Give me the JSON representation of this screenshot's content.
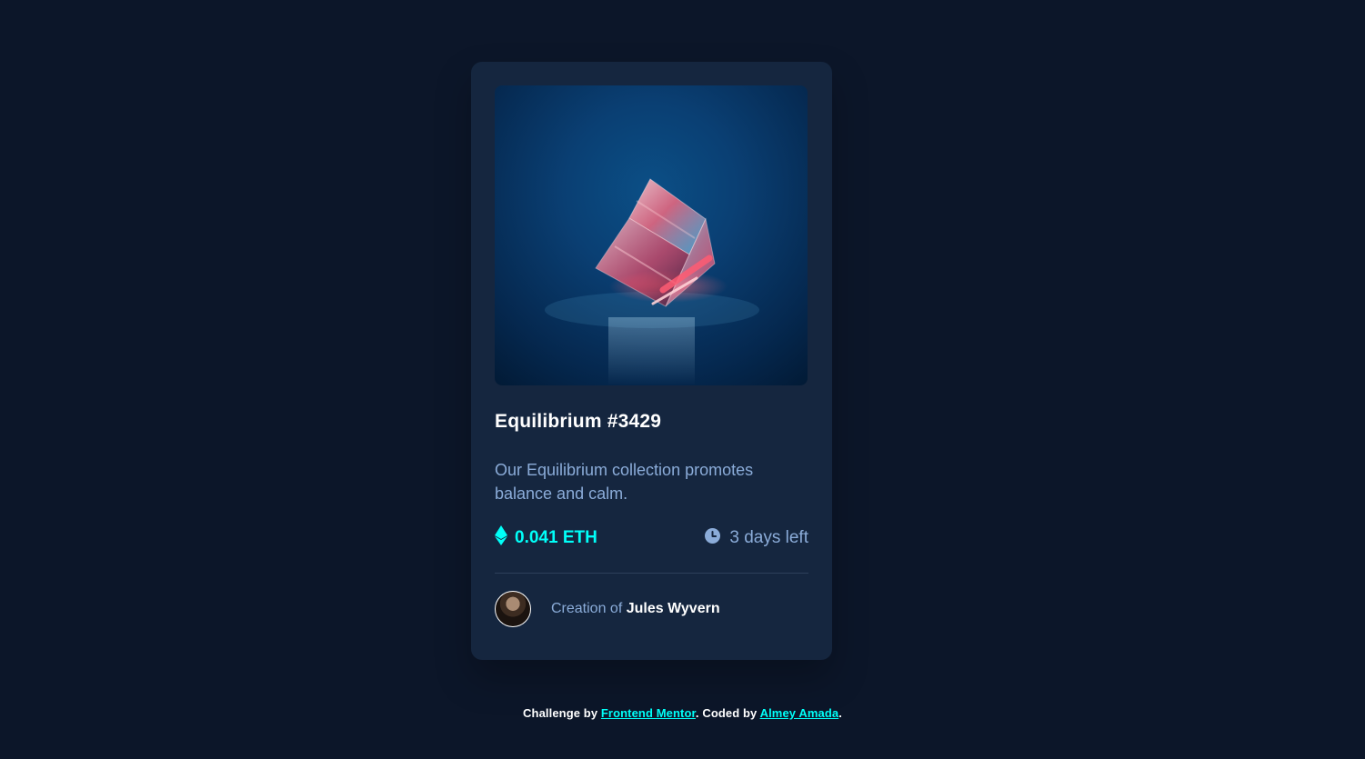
{
  "card": {
    "title": "Equilibrium #3429",
    "description": "Our Equilibrium collection promotes balance and calm.",
    "price": "0.041 ETH",
    "time_left": "3 days left",
    "creator_prefix": "Creation of",
    "creator_name": "Jules Wyvern"
  },
  "footer": {
    "text_1": "Challenge by",
    "link_1": "Frontend Mentor",
    "text_2": ". Coded by",
    "link_2": "Almey Amada",
    "text_3": "."
  },
  "icons": {
    "price": "ethereum-icon",
    "time": "clock-icon"
  },
  "colors": {
    "page_bg": "#0c1629",
    "card_bg": "#15263f",
    "accent": "#00fff8",
    "muted_text": "#8bacd9",
    "white": "#ffffff"
  }
}
